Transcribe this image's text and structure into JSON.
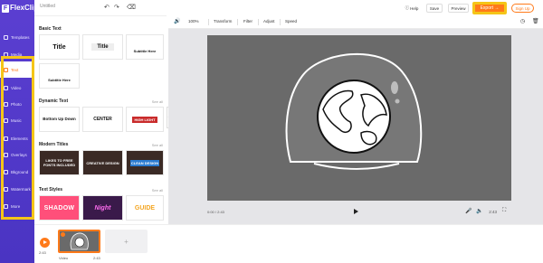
{
  "brand": {
    "name": "FlexClip"
  },
  "project": {
    "title_placeholder": "Untitled"
  },
  "sidebar": {
    "items": [
      {
        "label": "Templates"
      },
      {
        "label": "Media"
      },
      {
        "label": "Text",
        "active": true
      },
      {
        "label": "Video"
      },
      {
        "label": "Photo"
      },
      {
        "label": "Music"
      },
      {
        "label": "Elements"
      },
      {
        "label": "Overlays"
      },
      {
        "label": "Bkground"
      },
      {
        "label": "Watermark"
      },
      {
        "label": "More"
      }
    ]
  },
  "library": {
    "basic_text": {
      "title": "Basic Text",
      "tiles": [
        "Title",
        "Title",
        "Subtitle Here",
        "Subtitle Here"
      ]
    },
    "dynamic_text": {
      "title": "Dynamic Text",
      "see_all": "See all",
      "tiles": [
        "Bottom Up Down",
        "CENTER",
        "HIGH LIGHT"
      ]
    },
    "modern_titles": {
      "title": "Modern Titles",
      "see_all": "See all",
      "tiles": [
        "LIKES TO FREE FONTS INCLUDED",
        "CREATIVE DESIGN",
        "CLEAN DESIGN"
      ]
    },
    "text_styles": {
      "title": "Text Styles",
      "see_all": "See all",
      "tiles": [
        "SHADOW",
        "Night",
        "GUIDE"
      ]
    }
  },
  "topbar": {
    "help": "Help",
    "save": "Save",
    "preview": "Preview",
    "export": "Export →",
    "signup": "Sign Up"
  },
  "toolbar": {
    "zoom": "100%",
    "transform": "Transform",
    "filter": "Filter",
    "adjust": "Adjust",
    "speed": "Speed"
  },
  "player": {
    "time": "0:00 / 2:43",
    "duration": "2:43"
  },
  "timeline": {
    "total_time": "2:43",
    "clip_label": "Video",
    "clip_duration": "2:43"
  },
  "colors": {
    "accent": "#ff7a1a",
    "sidebar": "#5b3fd1",
    "highlight": "#f5c518"
  },
  "icons": [
    "undo-icon",
    "redo-icon",
    "volume-icon",
    "play-icon",
    "mic-icon",
    "fullscreen-icon",
    "history-icon",
    "trash-icon",
    "help-icon"
  ]
}
